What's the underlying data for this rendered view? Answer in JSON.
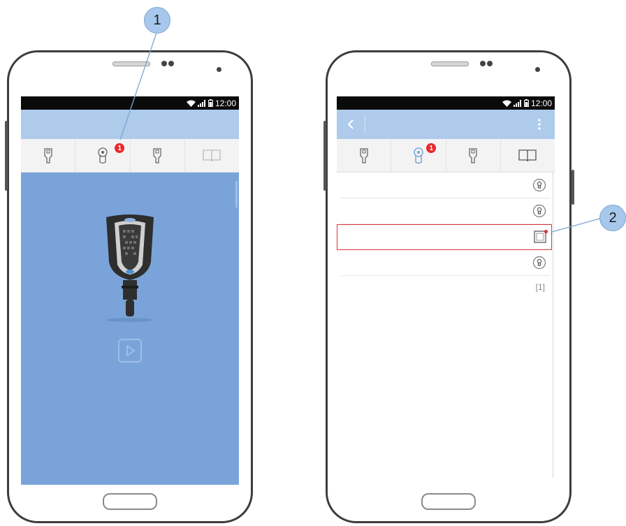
{
  "callouts": [
    "1",
    "2"
  ],
  "left_phone": {
    "status_time": "12:00",
    "tabs": [
      {
        "icon": "key-icon"
      },
      {
        "icon": "cylinder-lock-icon",
        "badge": "1"
      },
      {
        "icon": "key-icon"
      },
      {
        "icon": "book-icon"
      }
    ],
    "hero_icon": "digital-key-image",
    "play_icon": "play-icon",
    "colors": {
      "hero_background": "#7aa4d9",
      "appbar": "#aecbec"
    }
  },
  "right_phone": {
    "status_time": "12:00",
    "back_icon": "back-chevron-icon",
    "menu_icon": "overflow-menu-icon",
    "tabs": [
      {
        "icon": "key-icon"
      },
      {
        "icon": "cylinder-lock-icon",
        "badge": "1",
        "active": true
      },
      {
        "icon": "key-icon"
      },
      {
        "icon": "book-icon"
      }
    ],
    "list_items": [
      {
        "icon": "lock-icon",
        "highlighted": false
      },
      {
        "icon": "lock-icon",
        "highlighted": false
      },
      {
        "icon": "device-alert-icon",
        "highlighted": true
      },
      {
        "icon": "lock-icon",
        "highlighted": false
      }
    ],
    "page_indicator": "[1]",
    "colors": {
      "highlight": "#d9363e",
      "badge": "#e8282c"
    }
  }
}
